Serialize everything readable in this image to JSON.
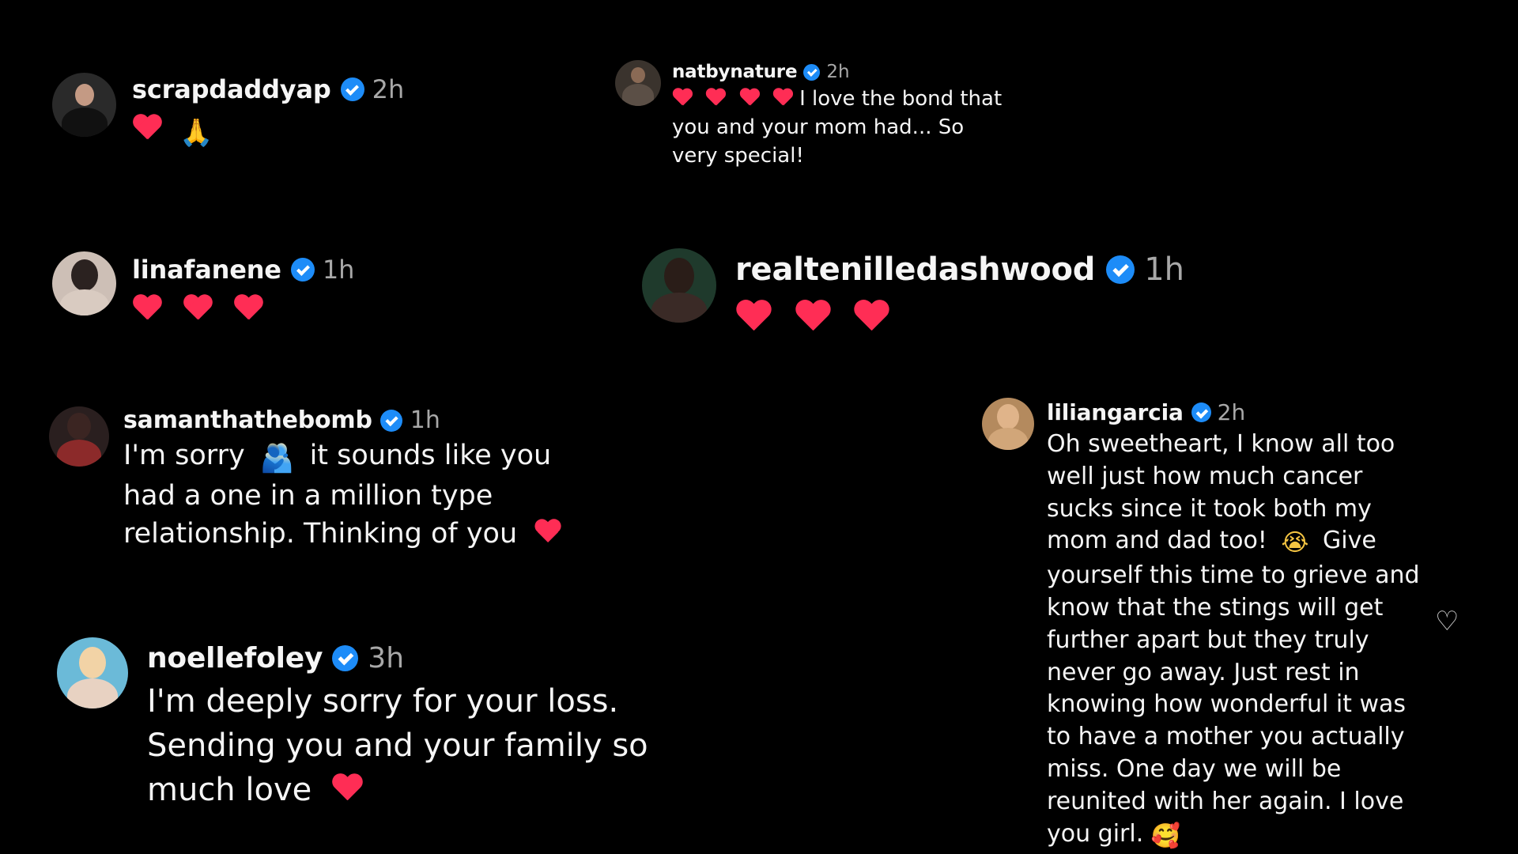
{
  "comments": [
    {
      "username": "scrapdaddyap",
      "verified": true,
      "time": "2h",
      "text": "",
      "emojis": [
        "red-heart",
        "folded-hands"
      ]
    },
    {
      "username": "natbynature",
      "verified": true,
      "time": "2h",
      "emojis": [
        "red-heart",
        "red-heart",
        "red-heart",
        "red-heart"
      ],
      "text": "I love the bond that you and your mom had... So very special!"
    },
    {
      "username": "linafanene",
      "verified": true,
      "time": "1h",
      "text": "",
      "emojis": [
        "red-heart",
        "red-heart",
        "red-heart"
      ]
    },
    {
      "username": "realtenilledashwood",
      "verified": true,
      "time": "1h",
      "text": "",
      "emojis": [
        "red-heart",
        "red-heart",
        "red-heart"
      ]
    },
    {
      "username": "samanthathebomb",
      "verified": true,
      "time": "1h",
      "text_part1": "I'm sorry",
      "inline_emoji": "hugging-people",
      "text_part2": "it sounds like you had a one in a million type relationship. Thinking of you",
      "trailing_emoji": "red-heart"
    },
    {
      "username": "liliangarcia",
      "verified": true,
      "time": "2h",
      "text_part1": "Oh sweetheart, I know all too well just how much cancer sucks since it took both my mom and dad too!",
      "inline_emoji": "crying-face",
      "text_part2": "Give yourself this time to grieve and know that the stings will get further apart but they truly never go away. Just rest in knowing how wonderful it was to have a mother you actually miss. One day we will be reunited with her again. I love you girl.",
      "trailing_emoji": "smiling-face-with-hearts"
    },
    {
      "username": "noellefoley",
      "verified": true,
      "time": "3h",
      "text": "I'm deeply sorry for your loss. Sending you and your family so much love",
      "trailing_emoji": "red-heart"
    }
  ],
  "colors": {
    "background": "#000000",
    "verified": "#1d8cf8",
    "heart": "#ff2d55",
    "timestamp": "#a8a8a8"
  }
}
